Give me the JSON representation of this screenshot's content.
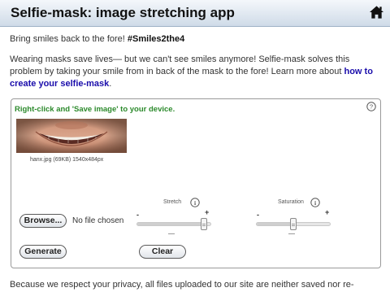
{
  "header": {
    "title": "Selfie-mask: image stretching app",
    "home_icon": "home-icon"
  },
  "intro": {
    "line1_prefix": "Bring smiles back to the fore! ",
    "hashtag": "#Smiles2the4",
    "paragraph": "Wearing masks save lives— but we can't see smiles anymore! Selfie-mask solves this problem by taking your smile from in back of the mask to the fore! Learn more about ",
    "link_text": "how to create your selfie-mask",
    "paragraph_end": "."
  },
  "panel": {
    "save_hint": "Right-click and 'Save image' to your device.",
    "help_icon": "question-circle-icon",
    "image_caption": "hanx.jpg (69KB) 1540x484px"
  },
  "sliders": {
    "stretch": {
      "label": "Stretch",
      "info_icon": "info-icon",
      "minus": "-",
      "plus": "+",
      "value_fraction": 0.94
    },
    "saturation": {
      "label": "Saturation",
      "info_icon": "info-icon",
      "minus": "-",
      "plus": "+",
      "value_fraction": 0.5
    }
  },
  "file_input": {
    "browse_label": "Browse...",
    "status": "No file chosen"
  },
  "buttons": {
    "generate": "Generate",
    "clear": "Clear"
  },
  "footer": {
    "text": "Because we respect your privacy, all files uploaded to our site are neither saved nor re-"
  },
  "colors": {
    "hint_green": "#2c8a2c",
    "link_blue": "#1a0dab"
  }
}
